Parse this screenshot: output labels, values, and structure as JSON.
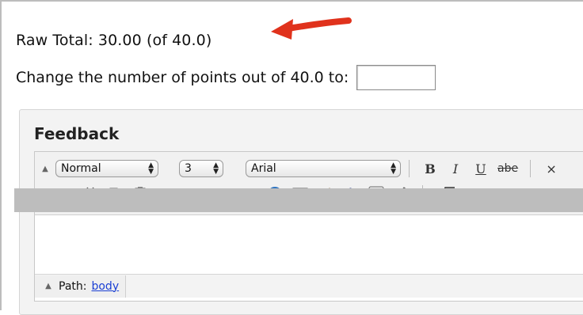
{
  "grade": {
    "raw_total_label": "Raw Total: 30.00 (of 40.0)",
    "change_points_label": "Change the number of points out of 40.0 to:",
    "points_input_value": ""
  },
  "feedback": {
    "title": "Feedback",
    "toolbar": {
      "format_select": "Normal",
      "size_select": "3",
      "font_select": "Arial",
      "bold": "B",
      "italic": "I",
      "underline": "U",
      "strikethrough": "abe",
      "more": "×",
      "spellcheck": "abc"
    },
    "path_label": "Path:",
    "path_value": "body"
  },
  "colors": {
    "arrow": "#e0321c",
    "link": "#1a3fd4",
    "font_color_underline": "#d61f1f",
    "highlight": "#f2e21a"
  }
}
